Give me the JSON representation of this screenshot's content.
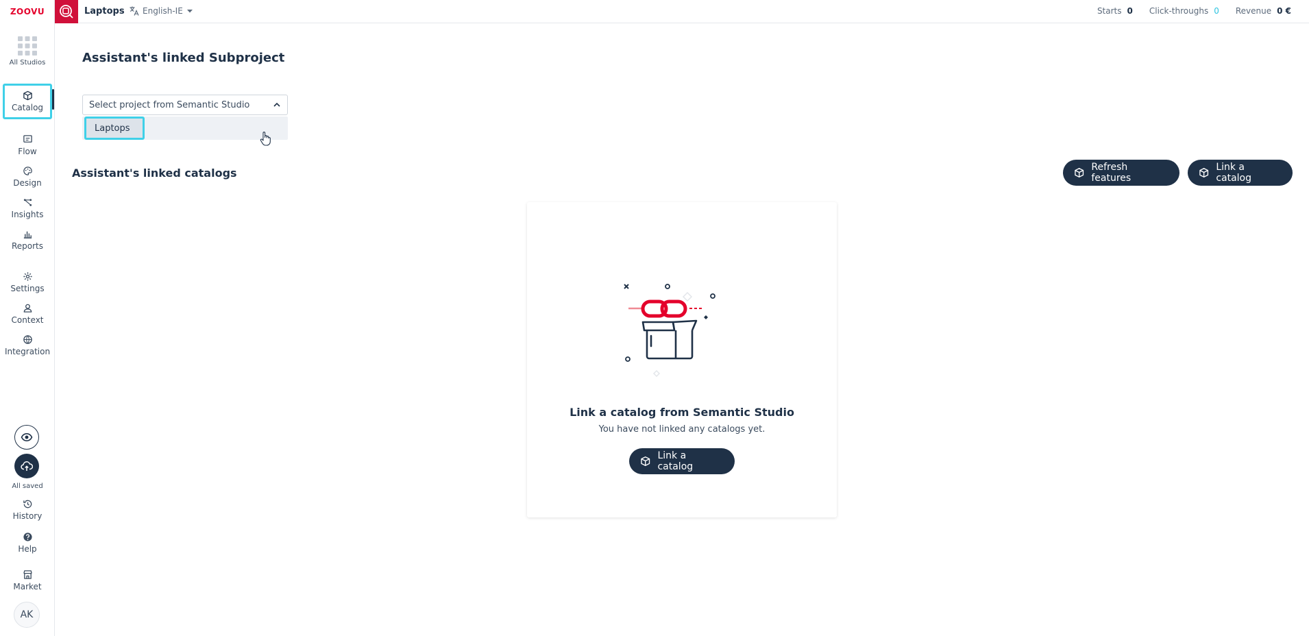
{
  "brand": {
    "logo_text": "ZOOVU",
    "accent": "#d0103a",
    "dark": "#1f3147",
    "highlight": "#3fd0e8"
  },
  "topbar": {
    "app_name": "Laptops",
    "language": "English-IE",
    "stats": [
      {
        "label": "Starts",
        "value": "0"
      },
      {
        "label": "Click-throughs",
        "value": "0"
      },
      {
        "label": "Revenue",
        "value": "0 €"
      }
    ]
  },
  "sidebar": {
    "all_studios": "All Studios",
    "items": [
      {
        "label": "Catalog",
        "icon": "cube-icon"
      },
      {
        "label": "Flow",
        "icon": "flow-icon"
      },
      {
        "label": "Design",
        "icon": "palette-icon"
      },
      {
        "label": "Insights",
        "icon": "insights-icon"
      },
      {
        "label": "Reports",
        "icon": "bar-chart-icon"
      },
      {
        "label": "Settings",
        "icon": "gear-icon"
      },
      {
        "label": "Context",
        "icon": "person-icon"
      },
      {
        "label": "Integration",
        "icon": "globe-icon"
      }
    ],
    "save_status": "All saved",
    "bottom_items": [
      {
        "label": "History",
        "icon": "history-icon"
      },
      {
        "label": "Help",
        "icon": "help-icon"
      },
      {
        "label": "Market",
        "icon": "store-icon"
      }
    ],
    "avatar_initials": "AK"
  },
  "main": {
    "subproject_heading": "Assistant's linked Subproject",
    "select_placeholder": "Select project from Semantic Studio",
    "dropdown_options": [
      "Laptops"
    ],
    "catalogs_heading": "Assistant's linked catalogs",
    "refresh_button": "Refresh features",
    "link_button": "Link a catalog",
    "empty_state": {
      "title": "Link a catalog from Semantic Studio",
      "subtitle": "You have not linked any catalogs yet.",
      "button": "Link a catalog"
    }
  }
}
